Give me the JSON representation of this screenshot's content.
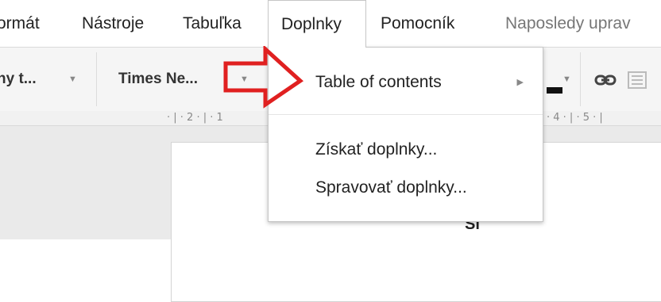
{
  "menubar": {
    "items": [
      {
        "label": "ormát"
      },
      {
        "label": "Nástroje"
      },
      {
        "label": "Tabuľka"
      },
      {
        "label": "Doplnky",
        "active": true
      },
      {
        "label": "Pomocník"
      }
    ],
    "last_edit": "Naposledy uprav"
  },
  "toolbar": {
    "style_dropdown": "ny t...",
    "font_dropdown": "Times Ne...",
    "link_icon": "link-icon",
    "colors": {
      "background": "#f5f5f5"
    }
  },
  "ruler": {
    "left_ticks": "· | · 2 · | · 1",
    "right_ticks": "· 4 · | · 5 · |"
  },
  "dropdown": {
    "items": [
      {
        "label": "Table of contents",
        "submenu": true
      },
      {
        "label": "Získať doplnky..."
      },
      {
        "label": "Spravovať doplnky..."
      }
    ]
  },
  "document": {
    "fragment": "Sl"
  },
  "annotation": {
    "type": "arrow",
    "color": "#e02020"
  }
}
